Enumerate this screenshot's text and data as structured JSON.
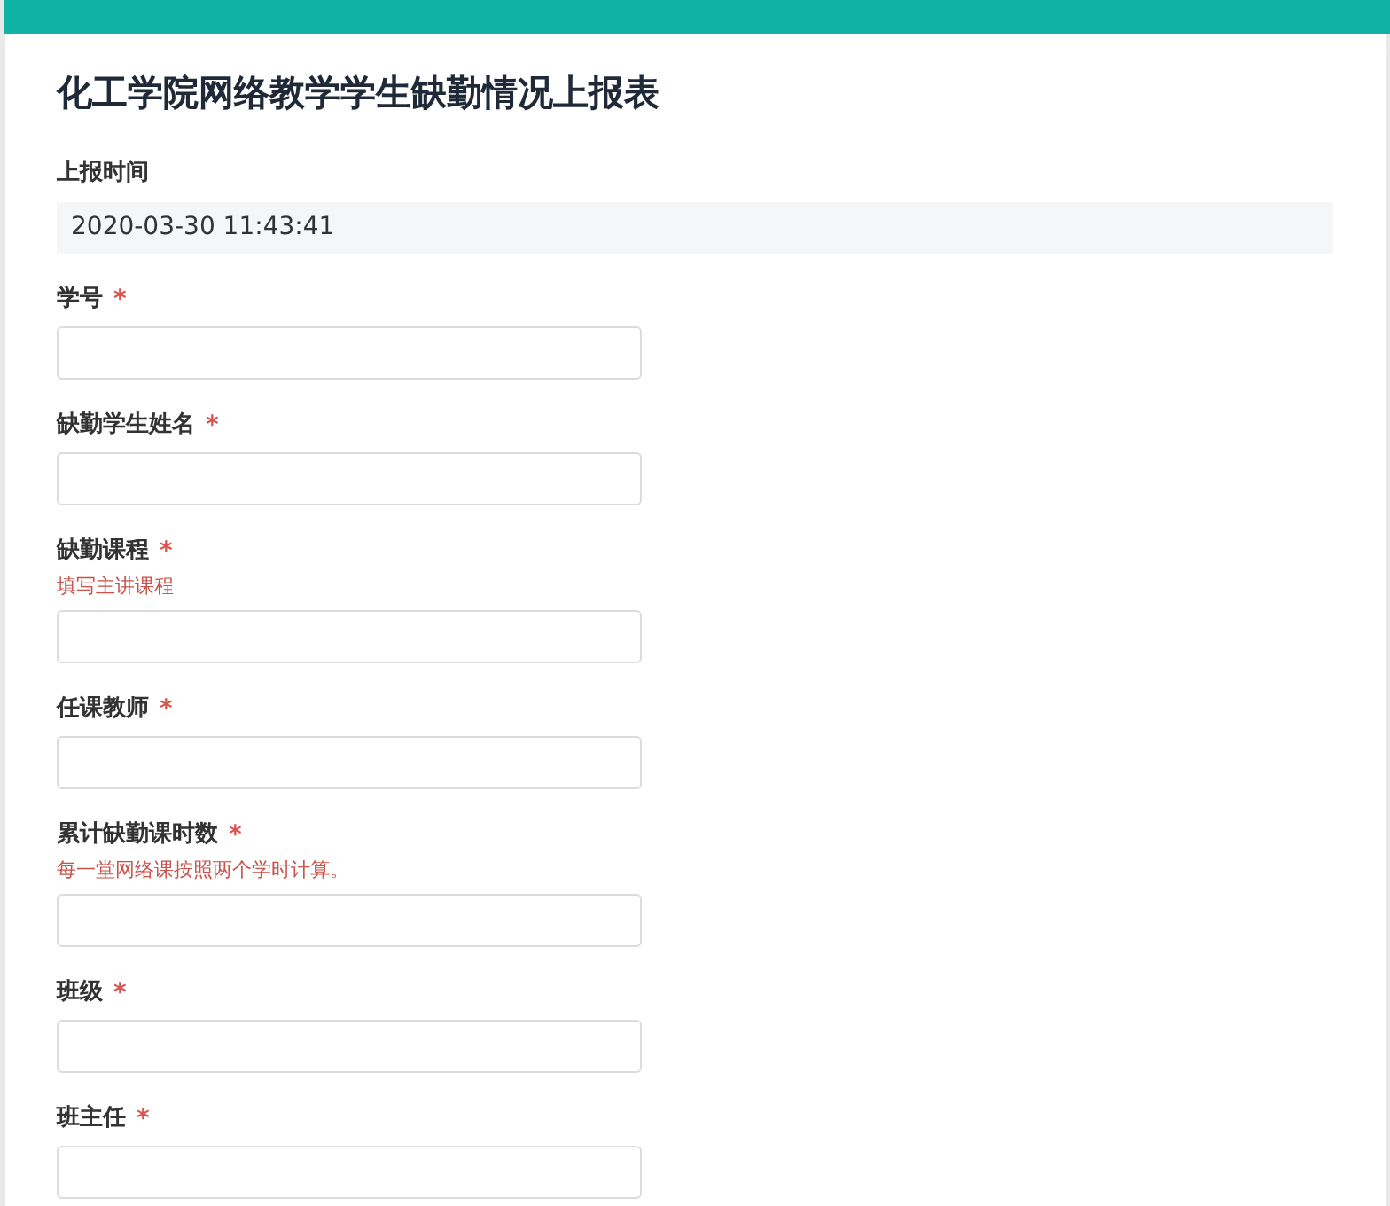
{
  "title": "化工学院网络教学学生缺勤情况上报表",
  "submit_time": {
    "label": "上报时间",
    "value": "2020-03-30 11:43:41"
  },
  "fields": [
    {
      "label": "学号",
      "required_mark": "*"
    },
    {
      "label": "缺勤学生姓名",
      "required_mark": "*"
    },
    {
      "label": "缺勤课程",
      "required_mark": "*",
      "hint": "填写主讲课程"
    },
    {
      "label": "任课教师",
      "required_mark": "*"
    },
    {
      "label": "累计缺勤课时数",
      "required_mark": "*",
      "hint": "每一堂网络课按照两个学时计算。"
    },
    {
      "label": "班级",
      "required_mark": "*"
    },
    {
      "label": "班主任",
      "required_mark": "*"
    }
  ]
}
